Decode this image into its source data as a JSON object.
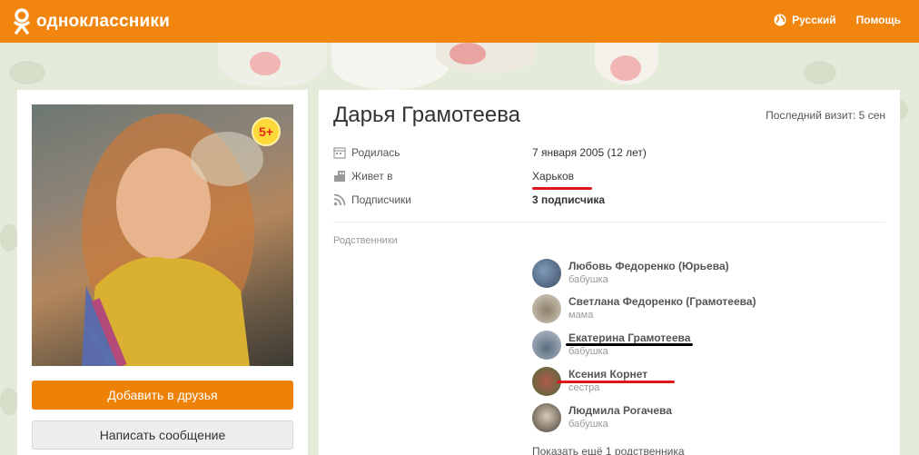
{
  "header": {
    "logo_text": "одноклассники",
    "language": "Русский",
    "help": "Помощь"
  },
  "profile": {
    "name": "Дарья Грамотеева",
    "age_badge": "5+",
    "last_visit": "Последний визит: 5 сен",
    "add_friend": "Добавить в друзья",
    "send_message": "Написать сообщение"
  },
  "info": {
    "born_label": "Родилась",
    "born_value": "7 января 2005 (12 лет)",
    "lives_label": "Живет в",
    "lives_value": "Харьков",
    "subscribers_label": "Подписчики",
    "subscribers_value": "3 подписчика"
  },
  "relatives": {
    "title": "Родственники",
    "items": [
      {
        "name": "Любовь Федоренко (Юрьева)",
        "role": "бабушка"
      },
      {
        "name": "Светлана Федоренко (Грамотеева)",
        "role": "мама"
      },
      {
        "name": "Екатерина Грамотеева",
        "role": "бабушка"
      },
      {
        "name": "Ксения Корнет",
        "role": "сестра"
      },
      {
        "name": "Людмила Рогачева",
        "role": "бабушка"
      }
    ],
    "show_more": "Показать ещё 1 родственника"
  },
  "colors": {
    "brand": "#f2850d",
    "underline_red": "#e0161f",
    "underline_black": "#000000"
  }
}
